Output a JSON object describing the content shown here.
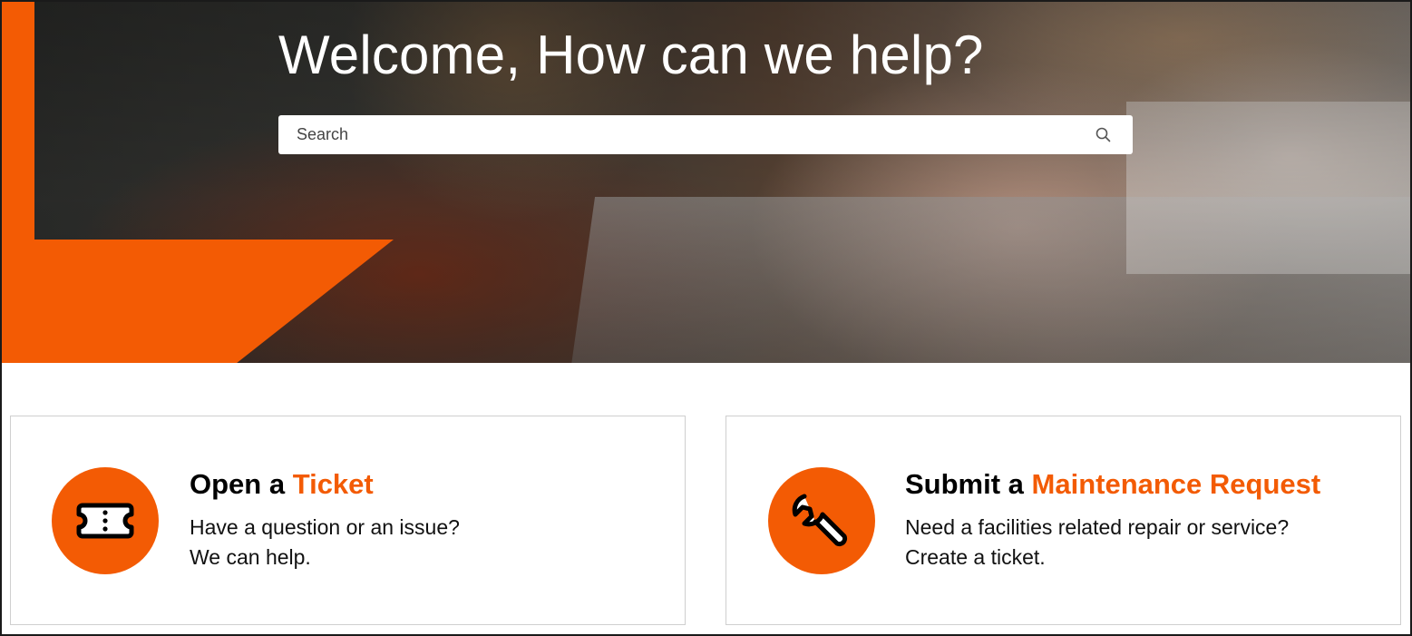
{
  "hero": {
    "title": "Welcome, How can we help?",
    "search_placeholder": "Search"
  },
  "cards": [
    {
      "title_prefix": "Open a ",
      "title_accent": "Ticket",
      "line1": "Have a question or an issue?",
      "line2": "We can help.",
      "icon": "ticket-icon"
    },
    {
      "title_prefix": "Submit a ",
      "title_accent": "Maintenance Request",
      "line1": "Need a facilities related repair or service?",
      "line2": "Create a ticket.",
      "icon": "wrench-icon"
    }
  ],
  "colors": {
    "accent": "#f35b04",
    "text": "#000000"
  }
}
